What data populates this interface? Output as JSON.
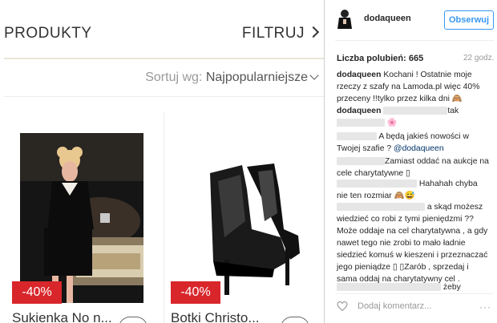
{
  "shop": {
    "title": "PRODUKTY",
    "filter_label": "FILTRUJ",
    "sort_label": "Sortuj wg:",
    "sort_value": "Najpopularniejsze",
    "products": [
      {
        "badge": "-40%",
        "name": "Sukienka No n..."
      },
      {
        "badge": "-40%",
        "name": "Botki Christo..."
      }
    ]
  },
  "post": {
    "username": "dodaqueen",
    "follow_label": "Obserwuj",
    "likes": "Liczba polubień: 665",
    "time": "22 godz.",
    "caption_user": "dodaqueen",
    "caption": "Kochani ! Ostatnie moje rzeczy z szafy na Lamoda.pl więc 40% przeceny !!tylko przez kilka dni 🙈",
    "comments": [
      {
        "user": "dodaqueen",
        "tail": "tak"
      },
      {
        "tail": "🌸"
      },
      {
        "text": "A będą jakieś nowości w Twojej szafie ?",
        "mention": "@dodaqueen"
      },
      {
        "text": "Zamiast oddać na aukcje na cele charytatywne ▯"
      },
      {
        "text": "Hahahah chyba nie ten rozmiar 🙈😅"
      },
      {
        "text": "a skąd możesz wiedzieć co robi z tymi pieniędzmi ?? Może oddaje na cel charytatywna , a gdy nawet tego nie zrobi to mało ładnie siedzieć komuś w kieszeni i przeznaczać jego pieniądze ▯ ▯Zarób , sprzedaj i sama oddaj na charytatywny cel ."
      },
      {
        "tail": "żeby"
      }
    ],
    "add_comment_placeholder": "Dodaj komentarz...",
    "more": "···"
  }
}
